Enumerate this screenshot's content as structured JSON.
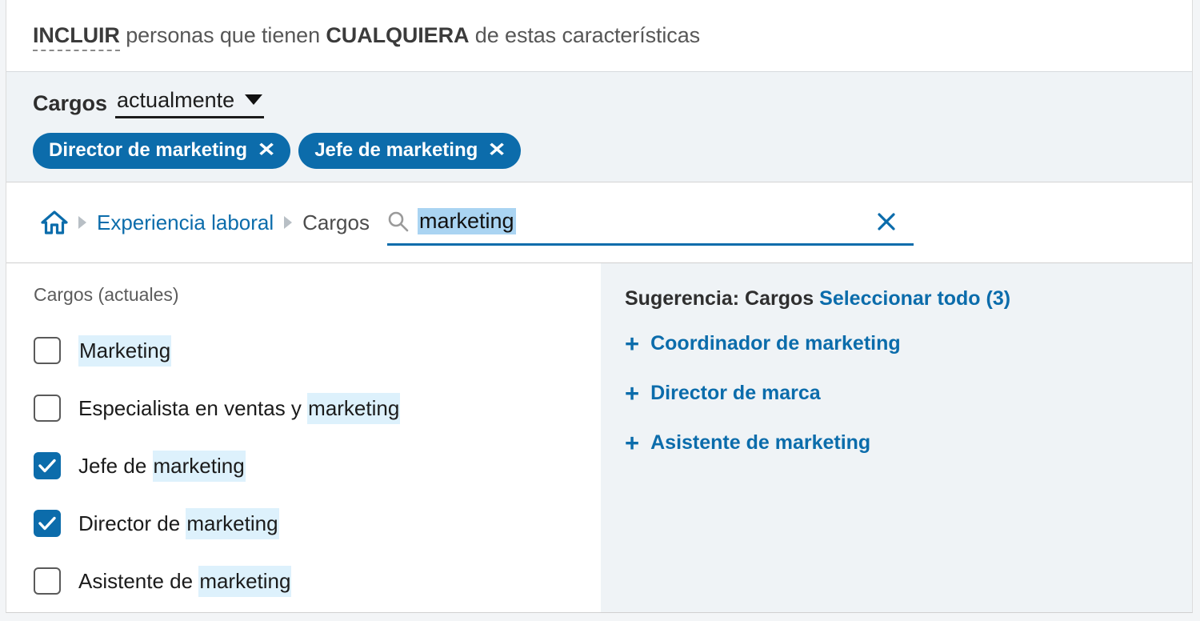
{
  "header": {
    "prefix_strong": "INCLUIR",
    "mid": " personas que tienen ",
    "any_strong": "CUALQUIERA",
    "suffix": " de estas características"
  },
  "facet": {
    "label": "Cargos",
    "select_value": "actualmente",
    "caret_icon": "chevron-down-icon",
    "pills": [
      {
        "label": "Director de marketing",
        "remove_icon": "close-icon",
        "remove_glyph": "✕"
      },
      {
        "label": "Jefe de marketing",
        "remove_icon": "close-icon",
        "remove_glyph": "✕"
      }
    ]
  },
  "breadcrumb": {
    "home_icon": "home-icon",
    "items": [
      {
        "label": "Experiencia laboral",
        "type": "link"
      },
      {
        "label": "Cargos",
        "type": "current"
      }
    ]
  },
  "search": {
    "icon": "search-icon",
    "value": "marketing",
    "placeholder": "",
    "clear_icon": "close-icon",
    "selected": true
  },
  "results": {
    "group_title": "Cargos (actuales)",
    "options": [
      {
        "pre": "",
        "match": "Marketing",
        "post": "",
        "checked": false
      },
      {
        "pre": "Especialista en ventas y ",
        "match": "marketing",
        "post": "",
        "checked": false
      },
      {
        "pre": "Jefe de ",
        "match": "marketing",
        "post": "",
        "checked": true
      },
      {
        "pre": "Director de ",
        "match": "marketing",
        "post": "",
        "checked": true
      },
      {
        "pre": "Asistente de ",
        "match": "marketing",
        "post": "",
        "checked": false
      }
    ]
  },
  "suggestions": {
    "title": "Sugerencia: Cargos",
    "select_all_label": "Seleccionar todo (3)",
    "items": [
      {
        "label": "Coordinador de marketing",
        "add_icon": "plus-icon",
        "add_glyph": "+"
      },
      {
        "label": "Director de marca",
        "add_icon": "plus-icon",
        "add_glyph": "+"
      },
      {
        "label": "Asistente de marketing",
        "add_icon": "plus-icon",
        "add_glyph": "+"
      }
    ]
  },
  "colors": {
    "accent_blue": "#0c6cab",
    "panel_bg": "#eff3f6",
    "highlight": "#ddf1fc",
    "selection": "#aad4f2"
  }
}
